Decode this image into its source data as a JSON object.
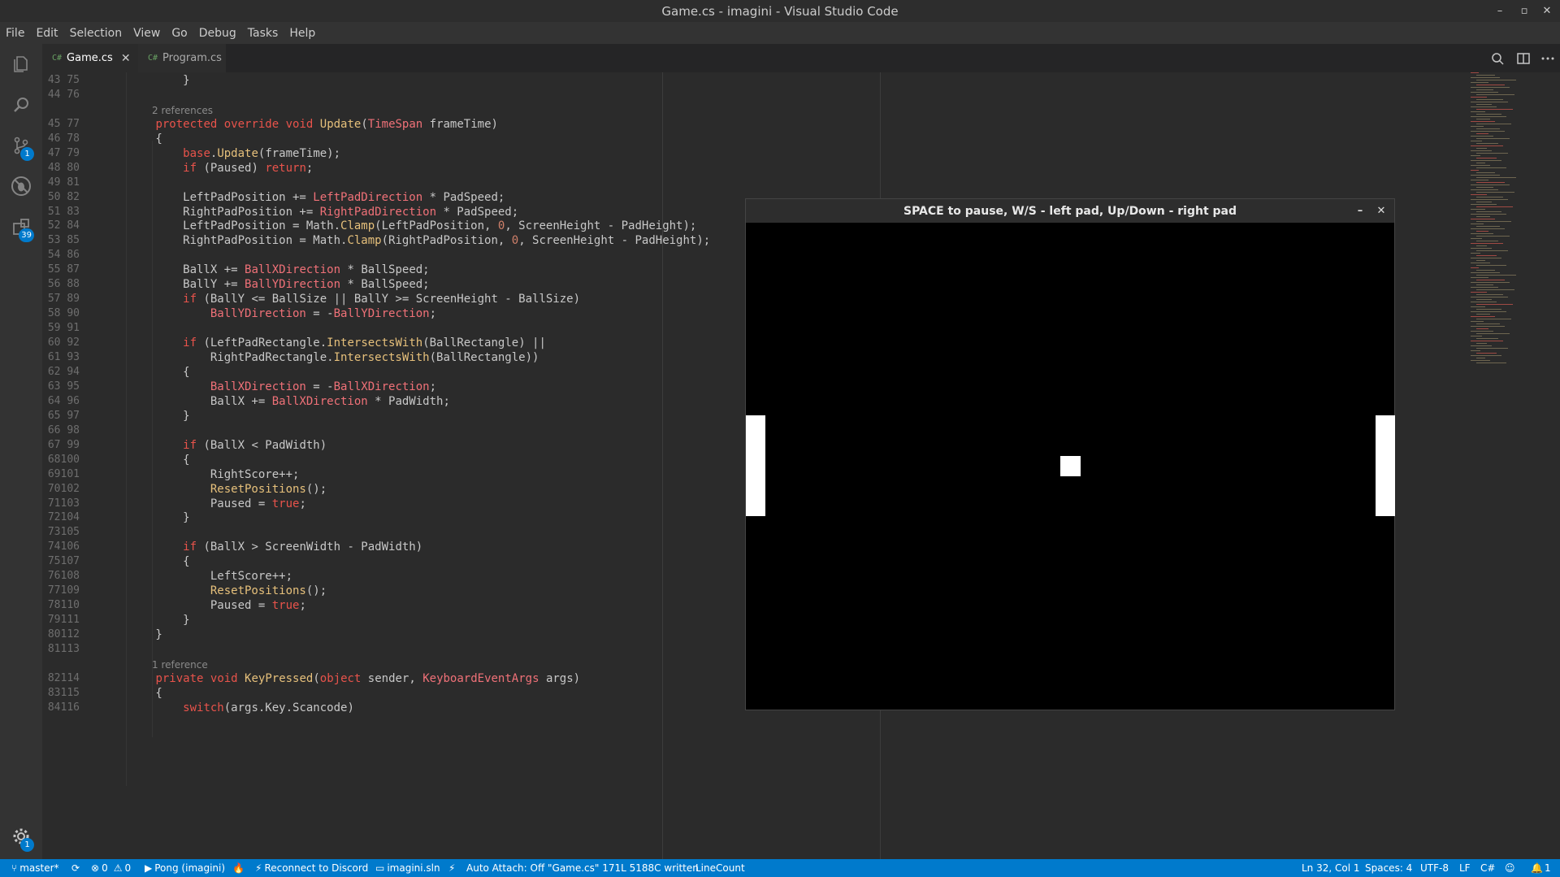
{
  "window": {
    "title": "Game.cs - imagini - Visual Studio Code",
    "min_glyph": "–",
    "max_glyph": "▫",
    "close_glyph": "✕"
  },
  "menu": [
    "File",
    "Edit",
    "Selection",
    "View",
    "Go",
    "Debug",
    "Tasks",
    "Help"
  ],
  "activity": {
    "scm_badge": "1",
    "ext_badge": "39",
    "settings_badge": "1"
  },
  "tabs": [
    {
      "icon": "C#",
      "label": "Game.cs",
      "close": "✕"
    },
    {
      "icon": "C#",
      "label": "Program.cs"
    }
  ],
  "editor": {
    "lines": [
      {
        "n": "43 75",
        "t": "    }"
      },
      {
        "n": "44 76",
        "t": ""
      },
      {
        "lens": "2 references"
      },
      {
        "n": "45 77",
        "t": "protected override void Update(TimeSpan frameTime)"
      },
      {
        "n": "46 78",
        "t": "{"
      },
      {
        "n": "47 79",
        "t": "    base.Update(frameTime);"
      },
      {
        "n": "48 80",
        "t": "    if (Paused) return;"
      },
      {
        "n": "49 81",
        "t": ""
      },
      {
        "n": "50 82",
        "t": "    LeftPadPosition += LeftPadDirection * PadSpeed;"
      },
      {
        "n": "51 83",
        "t": "    RightPadPosition += RightPadDirection * PadSpeed;"
      },
      {
        "n": "52 84",
        "t": "    LeftPadPosition = Math.Clamp(LeftPadPosition, 0, ScreenHeight - PadHeight);"
      },
      {
        "n": "53 85",
        "t": "    RightPadPosition = Math.Clamp(RightPadPosition, 0, ScreenHeight - PadHeight);"
      },
      {
        "n": "54 86",
        "t": ""
      },
      {
        "n": "55 87",
        "t": "    BallX += BallXDirection * BallSpeed;"
      },
      {
        "n": "56 88",
        "t": "    BallY += BallYDirection * BallSpeed;"
      },
      {
        "n": "57 89",
        "t": "    if (BallY <= BallSize || BallY >= ScreenHeight - BallSize)"
      },
      {
        "n": "58 90",
        "t": "        BallYDirection = -BallYDirection;"
      },
      {
        "n": "59 91",
        "t": ""
      },
      {
        "n": "60 92",
        "t": "    if (LeftPadRectangle.IntersectsWith(BallRectangle) ||"
      },
      {
        "n": "61 93",
        "t": "        RightPadRectangle.IntersectsWith(BallRectangle))"
      },
      {
        "n": "62 94",
        "t": "    {"
      },
      {
        "n": "63 95",
        "t": "        BallXDirection = -BallXDirection;"
      },
      {
        "n": "64 96",
        "t": "        BallX += BallXDirection * PadWidth;"
      },
      {
        "n": "65 97",
        "t": "    }"
      },
      {
        "n": "66 98",
        "t": ""
      },
      {
        "n": "67 99",
        "t": "    if (BallX < PadWidth)"
      },
      {
        "n": "68100",
        "t": "    {"
      },
      {
        "n": "69101",
        "t": "        RightScore++;"
      },
      {
        "n": "70102",
        "t": "        ResetPositions();"
      },
      {
        "n": "71103",
        "t": "        Paused = true;"
      },
      {
        "n": "72104",
        "t": "    }"
      },
      {
        "n": "73105",
        "t": ""
      },
      {
        "n": "74106",
        "t": "    if (BallX > ScreenWidth - PadWidth)"
      },
      {
        "n": "75107",
        "t": "    {"
      },
      {
        "n": "76108",
        "t": "        LeftScore++;"
      },
      {
        "n": "77109",
        "t": "        ResetPositions();"
      },
      {
        "n": "78110",
        "t": "        Paused = true;"
      },
      {
        "n": "79111",
        "t": "    }"
      },
      {
        "n": "80112",
        "t": "}"
      },
      {
        "n": "81113",
        "t": ""
      },
      {
        "lens": "1 reference"
      },
      {
        "n": "82114",
        "t": "private void KeyPressed(object sender, KeyboardEventArgs args)"
      },
      {
        "n": "83115",
        "t": "{"
      },
      {
        "n": "84116",
        "t": "    switch(args.Key.Scancode)"
      }
    ]
  },
  "game_window": {
    "title": "SPACE to pause, W/S - left pad, Up/Down - right pad",
    "min_glyph": "–",
    "close_glyph": "✕"
  },
  "status": {
    "branch": "master*",
    "errors": "0",
    "warnings": "0",
    "project": "Pong (imagini)",
    "discord": "Reconnect to Discord",
    "solution": "imagini.sln",
    "auto_attach": "Auto Attach: Off",
    "written": "\"Game.cs\" 171L 5188C written",
    "linecount": "LineCount",
    "position": "Ln 32, Col 1",
    "spaces": "Spaces: 4",
    "encoding": "UTF-8",
    "eol": "LF",
    "language": "C#",
    "bell_count": "1"
  },
  "colors": {
    "accent": "#007acc",
    "keyword": "#e8534b",
    "function": "#e6c07b"
  }
}
